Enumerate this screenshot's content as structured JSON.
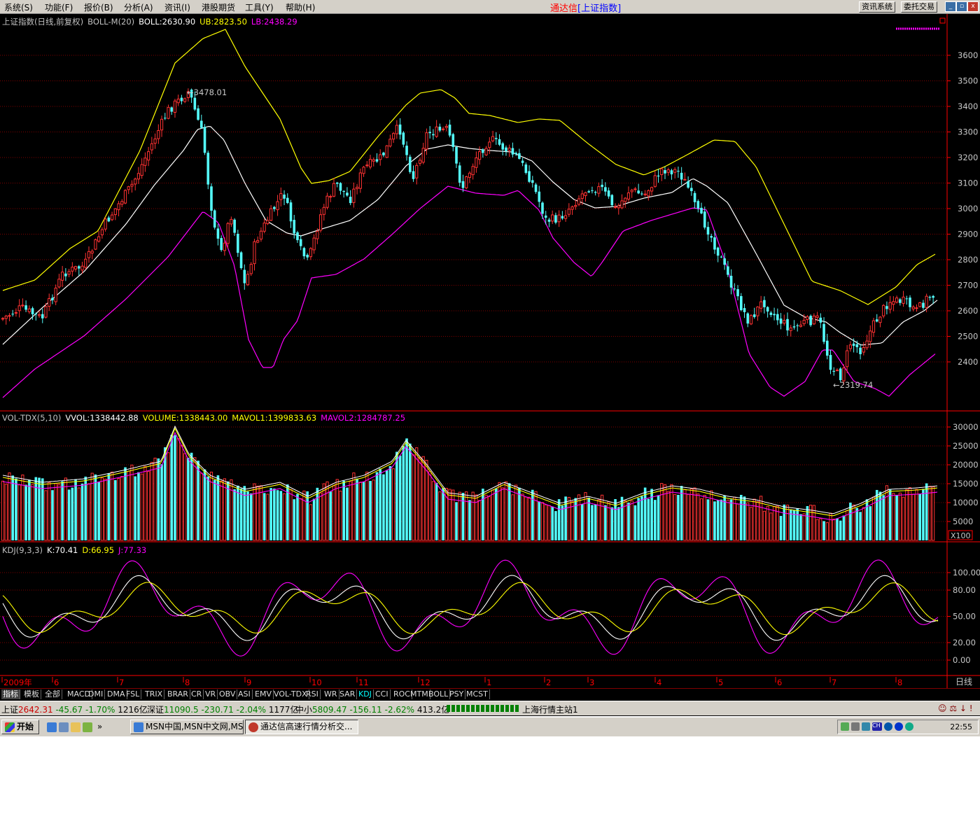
{
  "menu": [
    "系统(S)",
    "功能(F)",
    "报价(B)",
    "分析(A)",
    "资讯(I)",
    "港股期货",
    "工具(Y)",
    "帮助(H)"
  ],
  "title": {
    "app": "通达信",
    "instrument": "[上证指数]"
  },
  "toolbar_buttons": [
    "资讯系统",
    "委托交易"
  ],
  "price_panel": {
    "legend": {
      "name": "上证指数(日线,前复权)",
      "indicator": "BOLL-M(20)",
      "boll": "BOLL:2630.90",
      "ub": "UB:2823.50",
      "lb": "LB:2438.29"
    },
    "y_ticks": [
      "3600",
      "3500",
      "3400",
      "3300",
      "3200",
      "3100",
      "3000",
      "2900",
      "2800",
      "2700",
      "2600",
      "2500",
      "2400"
    ],
    "high_annotation": "3478.01",
    "low_annotation": "2319.74"
  },
  "volume_panel": {
    "legend": {
      "name": "VOL-TDX(5,10)",
      "vvol": "VVOL:1338442.88",
      "volume": "VOLUME:1338443.00",
      "mavol1": "MAVOL1:1399833.63",
      "mavol2": "MAVOL2:1284787.25"
    },
    "y_ticks": [
      "30000",
      "25000",
      "20000",
      "15000",
      "10000",
      "5000"
    ],
    "unit": "X100"
  },
  "kdj_panel": {
    "legend": {
      "name": "KDJ(9,3,3)",
      "k": "K:70.41",
      "d": "D:66.95",
      "j": "J:77.33"
    },
    "y_ticks": [
      "100.00",
      "80.00",
      "50.00",
      "20.00",
      "0.00"
    ]
  },
  "time_axis": {
    "labels": [
      "2009年",
      "6",
      "7",
      "8",
      "9",
      "10",
      "11",
      "12",
      "1",
      "2",
      "3",
      "4",
      "5",
      "6",
      "7",
      "8"
    ],
    "period": "日线"
  },
  "indicator_tabs": [
    "指标",
    "模板",
    "全部",
    "MACD",
    "DMI",
    "DMA",
    "FSL",
    "TRIX",
    "BRAR",
    "CR",
    "VR",
    "OBV",
    "ASI",
    "EMV",
    "VOL-TDX",
    "RSI",
    "WR",
    "SAR",
    "KDJ",
    "CCI",
    "ROC",
    "MTM",
    "BOLL",
    "PSY",
    "MCST"
  ],
  "active_tab": "KDJ",
  "market_status": {
    "sh_label": "上证",
    "sh_value": "2642.31",
    "sh_change": "-45.67",
    "sh_pct": "-1.70%",
    "sh_amount": "1216亿",
    "sz_label": "深证",
    "sz_value": "11090.5",
    "sz_change": "-230.71",
    "sz_pct": "-2.04%",
    "sz_amount": "1177亿",
    "zx_label": "中小",
    "zx_value": "5809.47",
    "zx_change": "-156.11",
    "zx_pct": "-2.62%",
    "zx_amount": "413.2亿",
    "server": "上海行情主站1"
  },
  "taskbar": {
    "start": "开始",
    "tasks": [
      "MSN中国,MSN中文网,MS...",
      "通达信高速行情分析交..."
    ],
    "clock": "22:55"
  },
  "colors": {
    "up": "#ff3232",
    "down": "#54fcfc",
    "ub": "#ffff00",
    "mid": "#ffffff",
    "lb": "#ff00ff",
    "grid": "#800000",
    "axis": "#ff0000"
  }
}
